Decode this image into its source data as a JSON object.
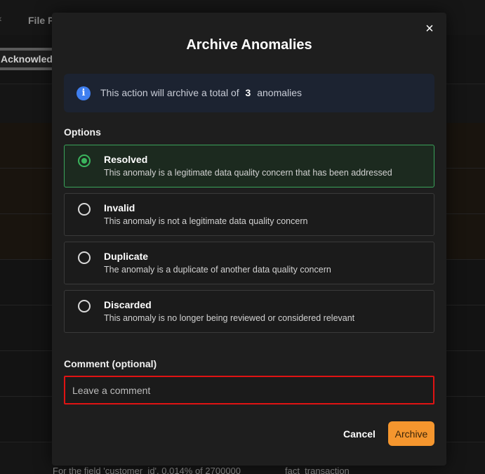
{
  "background": {
    "tab_label": "File P",
    "acknowledge_button": "Acknowledg",
    "footer_text_1": "For the field 'customer_id', 0.014% of 2700000",
    "footer_text_2": "fact_transaction"
  },
  "modal": {
    "title": "Archive Anomalies",
    "close_icon": "×",
    "info": {
      "icon": "i",
      "text_before": "This action will archive a total of",
      "count": "3",
      "text_after": "anomalies"
    },
    "options_label": "Options",
    "options": [
      {
        "title": "Resolved",
        "description": "This anomaly is a legitimate data quality concern that has been addressed",
        "selected": true
      },
      {
        "title": "Invalid",
        "description": "This anomaly is not a legitimate data quality concern",
        "selected": false
      },
      {
        "title": "Duplicate",
        "description": "The anomaly is a duplicate of another data quality concern",
        "selected": false
      },
      {
        "title": "Discarded",
        "description": "This anomaly is no longer being reviewed or considered relevant",
        "selected": false
      }
    ],
    "comment_label": "Comment (optional)",
    "comment_placeholder": "Leave a comment",
    "comment_value": "",
    "cancel_label": "Cancel",
    "archive_label": "Archive"
  },
  "colors": {
    "accent": "#f5962e",
    "selected_border": "#3aa35a",
    "info_icon": "#3f7ff0",
    "error_border": "#e01313"
  }
}
